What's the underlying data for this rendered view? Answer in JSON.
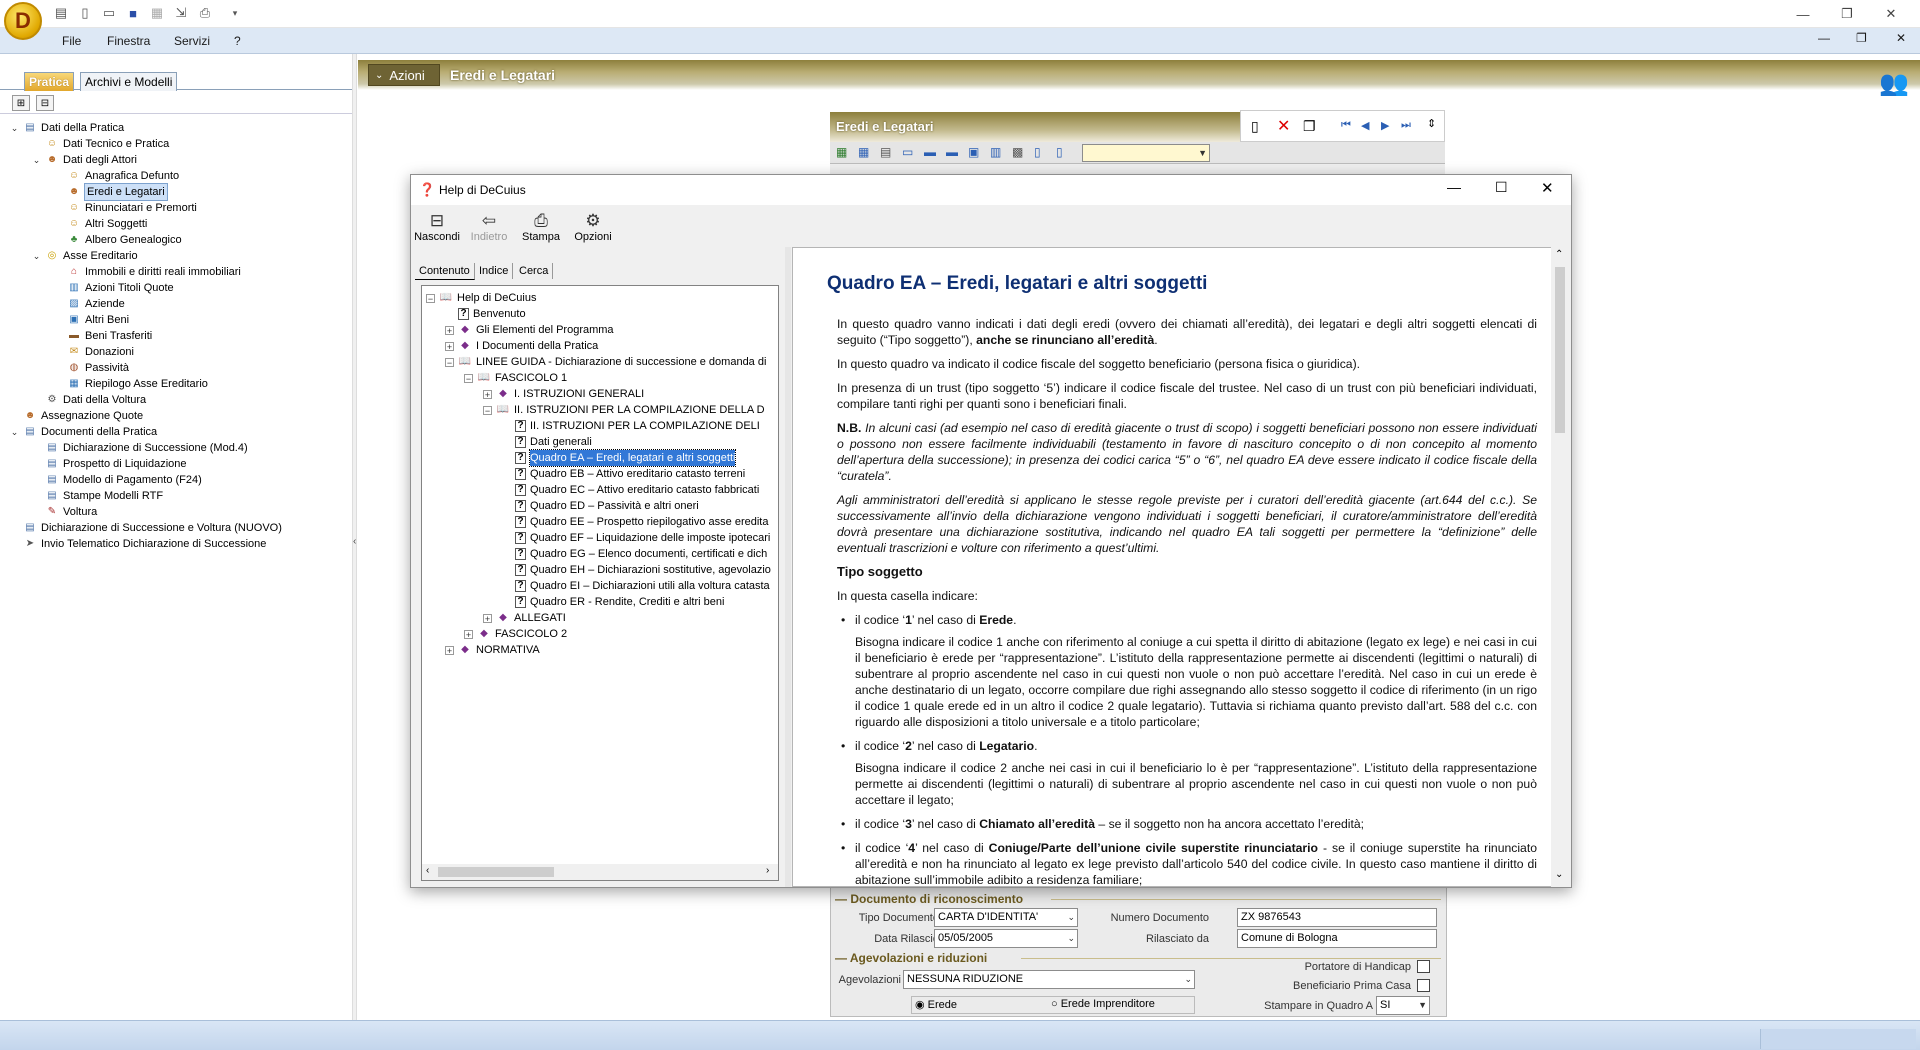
{
  "app": {
    "logo_letter": "D",
    "accent": "#e2a72c",
    "menu": [
      "File",
      "Finestra",
      "Servizi",
      "?"
    ]
  },
  "left_panel": {
    "tabs": [
      "Pratica",
      "Archivi e Modelli"
    ],
    "tree": [
      {
        "label": "Dati della Pratica",
        "level": 0,
        "expander": "v",
        "icon": "doc-icon"
      },
      {
        "label": "Dati Tecnico e Pratica",
        "level": 1,
        "expander": "",
        "icon": "person-icon"
      },
      {
        "label": "Dati degli Attori",
        "level": 1,
        "expander": "v",
        "icon": "people-icon"
      },
      {
        "label": "Anagrafica Defunto",
        "level": 2,
        "expander": "",
        "icon": "person-icon"
      },
      {
        "label": "Eredi e Legatari",
        "level": 2,
        "expander": "",
        "icon": "people-icon",
        "selected": true
      },
      {
        "label": "Rinunciatari e Premorti",
        "level": 2,
        "expander": "",
        "icon": "person-icon"
      },
      {
        "label": "Altri Soggetti",
        "level": 2,
        "expander": "",
        "icon": "person-icon"
      },
      {
        "label": "Albero Genealogico",
        "level": 2,
        "expander": "",
        "icon": "tree-icon"
      },
      {
        "label": "Asse Ereditario",
        "level": 1,
        "expander": "v",
        "icon": "coins-icon"
      },
      {
        "label": "Immobili e diritti reali immobiliari",
        "level": 2,
        "expander": "",
        "icon": "house-icon"
      },
      {
        "label": "Azioni Titoli Quote",
        "level": 2,
        "expander": "",
        "icon": "chart-icon"
      },
      {
        "label": "Aziende",
        "level": 2,
        "expander": "",
        "icon": "factory-icon"
      },
      {
        "label": "Altri Beni",
        "level": 2,
        "expander": "",
        "icon": "box-icon"
      },
      {
        "label": "Beni Trasferiti",
        "level": 2,
        "expander": "",
        "icon": "briefcase-icon"
      },
      {
        "label": "Donazioni",
        "level": 2,
        "expander": "",
        "icon": "gift-icon"
      },
      {
        "label": "Passività",
        "level": 2,
        "expander": "",
        "icon": "bag-icon"
      },
      {
        "label": "Riepilogo Asse Ereditario",
        "level": 2,
        "expander": "",
        "icon": "summary-icon"
      },
      {
        "label": "Dati della Voltura",
        "level": 1,
        "expander": "",
        "icon": "gear-icon"
      },
      {
        "label": "Assegnazione Quote",
        "level": 0,
        "expander": "",
        "icon": "people-icon"
      },
      {
        "label": "Documenti della Pratica",
        "level": 0,
        "expander": "v",
        "icon": "doc-icon"
      },
      {
        "label": "Dichiarazione di Successione (Mod.4)",
        "level": 1,
        "expander": "",
        "icon": "form-icon"
      },
      {
        "label": "Prospetto di Liquidazione",
        "level": 1,
        "expander": "",
        "icon": "form-icon"
      },
      {
        "label": "Modello di Pagamento (F24)",
        "level": 1,
        "expander": "",
        "icon": "form-icon"
      },
      {
        "label": "Stampe Modelli RTF",
        "level": 1,
        "expander": "",
        "icon": "form-icon"
      },
      {
        "label": "Voltura",
        "level": 1,
        "expander": "",
        "icon": "stamp-icon"
      },
      {
        "label": "Dichiarazione di Successione e Voltura (NUOVO)",
        "level": 0,
        "expander": "",
        "icon": "form-icon"
      },
      {
        "label": "Invio Telematico Dichiarazione di Successione",
        "level": 0,
        "expander": "",
        "icon": "send-icon"
      }
    ]
  },
  "header": {
    "actions_label": "Azioni",
    "title": "Eredi e Legatari"
  },
  "form": {
    "title": "Eredi e Legatari",
    "documento_section": "Documento di riconoscimento",
    "tipo_documento_label": "Tipo Documento",
    "tipo_documento_value": "CARTA D'IDENTITA'",
    "numero_documento_label": "Numero Documento",
    "numero_documento_value": "ZX 9876543",
    "data_rilascio_label": "Data Rilascio",
    "data_rilascio_value": "05/05/2005",
    "rilasciato_da_label": "Rilasciato da",
    "rilasciato_da_value": "Comune di Bologna",
    "agevolazioni_section": "Agevolazioni e riduzioni",
    "agevolazioni_label": "Agevolazioni",
    "agevolazioni_value": "NESSUNA RIDUZIONE",
    "portatore_handicap_label": "Portatore di Handicap",
    "beneficiario_prima_casa_label": "Beneficiario Prima Casa",
    "erede_label": "Erede",
    "erede_imprenditore_label": "Erede Imprenditore",
    "stampare_label": "Stampare in Quadro A",
    "stampare_value": "SI"
  },
  "help": {
    "title": "Help di DeCuius",
    "toolbar": [
      "Nascondi",
      "Indietro",
      "Stampa",
      "Opzioni"
    ],
    "tabs": [
      "Contenuto",
      "Indice",
      "Cerca"
    ],
    "tree": [
      {
        "label": "Help di DeCuius",
        "level": 0,
        "exp": "−",
        "icon": "book-open"
      },
      {
        "label": "Benvenuto",
        "level": 1,
        "exp": "",
        "icon": "topic"
      },
      {
        "label": "Gli Elementi del Programma",
        "level": 1,
        "exp": "+",
        "icon": "book"
      },
      {
        "label": "I Documenti della Pratica",
        "level": 1,
        "exp": "+",
        "icon": "book"
      },
      {
        "label": "LINEE GUIDA - Dichiarazione di successione e domanda di",
        "level": 1,
        "exp": "−",
        "icon": "book-open"
      },
      {
        "label": "FASCICOLO 1",
        "level": 2,
        "exp": "−",
        "icon": "book-open"
      },
      {
        "label": "I. ISTRUZIONI GENERALI",
        "level": 3,
        "exp": "+",
        "icon": "book"
      },
      {
        "label": "II. ISTRUZIONI PER LA COMPILAZIONE  DELLA D",
        "level": 3,
        "exp": "−",
        "icon": "book-open"
      },
      {
        "label": "II. ISTRUZIONI PER LA COMPILAZIONE  DELI",
        "level": 4,
        "exp": "",
        "icon": "topic"
      },
      {
        "label": "Dati generali",
        "level": 4,
        "exp": "",
        "icon": "topic"
      },
      {
        "label": "Quadro EA – Eredi, legatari e altri soggetti",
        "level": 4,
        "exp": "",
        "icon": "topic",
        "selected": true
      },
      {
        "label": "Quadro EB – Attivo ereditario catasto terreni",
        "level": 4,
        "exp": "",
        "icon": "topic"
      },
      {
        "label": "Quadro EC – Attivo ereditario catasto fabbricati",
        "level": 4,
        "exp": "",
        "icon": "topic"
      },
      {
        "label": "Quadro ED – Passività e altri oneri",
        "level": 4,
        "exp": "",
        "icon": "topic"
      },
      {
        "label": "Quadro EE – Prospetto riepilogativo asse eredita",
        "level": 4,
        "exp": "",
        "icon": "topic"
      },
      {
        "label": "Quadro EF – Liquidazione delle imposte ipotecari",
        "level": 4,
        "exp": "",
        "icon": "topic"
      },
      {
        "label": "Quadro EG – Elenco documenti, certificati e dich",
        "level": 4,
        "exp": "",
        "icon": "topic"
      },
      {
        "label": "Quadro EH – Dichiarazioni sostitutive, agevolazio",
        "level": 4,
        "exp": "",
        "icon": "topic"
      },
      {
        "label": "Quadro EI – Dichiarazioni utili alla voltura catasta",
        "level": 4,
        "exp": "",
        "icon": "topic"
      },
      {
        "label": "Quadro ER - Rendite, Crediti e altri beni",
        "level": 4,
        "exp": "",
        "icon": "topic"
      },
      {
        "label": "ALLEGATI",
        "level": 3,
        "exp": "+",
        "icon": "book"
      },
      {
        "label": "FASCICOLO 2",
        "level": 2,
        "exp": "+",
        "icon": "book"
      },
      {
        "label": "NORMATIVA",
        "level": 1,
        "exp": "+",
        "icon": "book"
      }
    ],
    "content": {
      "heading": "Quadro EA – Eredi, legatari e altri soggetti",
      "p1a": "In questo quadro vanno indicati i dati degli eredi (ovvero dei chiamati all’eredità), dei legatari e degli altri soggetti elencati di seguito (“Tipo soggetto”), ",
      "p1b": "anche se rinunciano all’eredità",
      "p1c": ".",
      "p2": "In questo quadro va indicato il codice fiscale del soggetto beneficiario (persona fisica o giuridica).",
      "p3": "In presenza di un trust (tipo soggetto ‘5’) indicare il codice fiscale del trustee. Nel caso di un trust con più beneficiari individuati, compilare tanti righi per quanti sono i beneficiari finali.",
      "nb_label": "N.B.",
      "nb": " In alcuni casi (ad esempio nel caso di eredità giacente o trust di scopo) i soggetti beneficiari possono non essere individuati o possono non essere facilmente individuabili  (testamento in favore di nascituro concepito o di non concepito al momento dell’apertura della successione); in presenza dei codici carica “5” o “6”, nel quadro EA deve essere indicato il codice fiscale della “curatela”.",
      "p4": "Agli amministratori dell’eredità si applicano le stesse regole previste per i curatori dell’eredità giacente (art.644 del c.c.). Se successivamente all’invio della dichiarazione vengono individuati i soggetti beneficiari, il curatore/amministratore dell’eredità dovrà presentare una dichiarazione sostitutiva, indicando nel quadro EA tali soggetti per permettere la “definizione” delle eventuali trascrizioni e volture con riferimento a quest’ultimi.",
      "tipo_heading": "Tipo soggetto",
      "casella": "In questa casella indicare:",
      "c1a": "il codice ‘",
      "c1b": "1",
      "c1c": "’ nel caso di ",
      "c1d": "Erede",
      "c1e": ".",
      "c1_desc": "Bisogna indicare il codice 1 anche con riferimento al coniuge a cui spetta il diritto di abitazione (legato ex lege) e nei casi in cui il beneficiario è erede per “rappresentazione”. L’istituto della rappresentazione permette ai discendenti (legittimi o naturali) di subentrare al proprio ascendente nel caso in cui questi non vuole o non può accettare l’eredità. Nel caso in cui un erede è anche destinatario di un legato, occorre compilare due righi assegnando allo stesso soggetto il codice di riferimento (in un rigo il codice 1 quale erede ed in un altro il codice 2 quale legatario). Tuttavia si richiama quanto previsto dall’art. 588 del c.c. con riguardo alle disposizioni a titolo universale e a titolo particolare;",
      "c2a": "il codice ‘",
      "c2b": "2",
      "c2c": "’ nel caso di ",
      "c2d": "Legatario",
      "c2e": ".",
      "c2_desc": "Bisogna indicare il codice 2 anche nei casi in cui il beneficiario lo è per “rappresentazione”. L’istituto della rappresentazione permette ai discendenti (legittimi o naturali) di subentrare al proprio ascendente nel caso in cui questi non vuole o non può accettare il legato;",
      "c3a": "il codice ‘",
      "c3b": "3",
      "c3c": "’ nel caso di ",
      "c3d": "Chiamato all’eredità",
      "c3e": " – se il soggetto non ha ancora accettato l’eredità;",
      "c4a": "il codice ‘",
      "c4b": "4",
      "c4c": "’ nel caso di ",
      "c4d": "Coniuge/Parte  dell’unione civile superstite rinunciatario",
      "c4e": " - se il coniuge superstite ha rinunciato all’eredità e non ha rinunciato al legato ex lege previsto dall’articolo 540 del codice civile. In questo caso mantiene il diritto di abitazione sull’immobile adibito a residenza familiare;"
    }
  }
}
